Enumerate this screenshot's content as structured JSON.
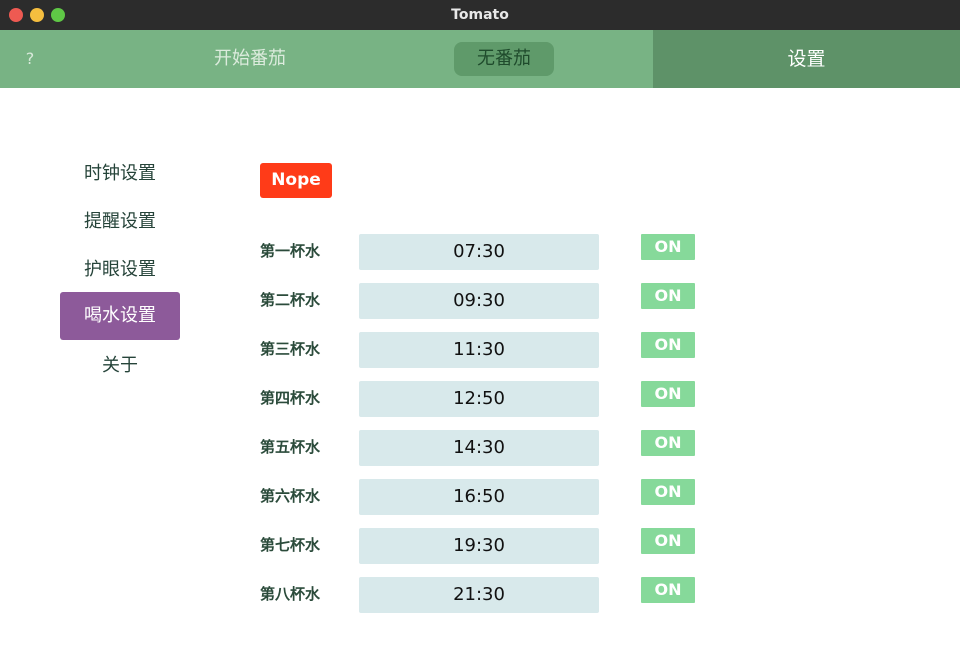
{
  "window": {
    "title": "Tomato"
  },
  "topnav": {
    "help": "?",
    "start": "开始番茄",
    "status": "无番茄",
    "settings": "设置"
  },
  "sidebar": {
    "items": [
      {
        "label": "时钟设置",
        "active": false
      },
      {
        "label": "提醒设置",
        "active": false
      },
      {
        "label": "护眼设置",
        "active": false
      },
      {
        "label": "喝水设置",
        "active": true
      },
      {
        "label": "关于",
        "active": false
      }
    ]
  },
  "main": {
    "nope_label": "Nope",
    "schedule": [
      {
        "label": "第一杯水",
        "time": "07:30",
        "toggle": "ON"
      },
      {
        "label": "第二杯水",
        "time": "09:30",
        "toggle": "ON"
      },
      {
        "label": "第三杯水",
        "time": "11:30",
        "toggle": "ON"
      },
      {
        "label": "第四杯水",
        "time": "12:50",
        "toggle": "ON"
      },
      {
        "label": "第五杯水",
        "time": "14:30",
        "toggle": "ON"
      },
      {
        "label": "第六杯水",
        "time": "16:50",
        "toggle": "ON"
      },
      {
        "label": "第七杯水",
        "time": "19:30",
        "toggle": "ON"
      },
      {
        "label": "第八杯水",
        "time": "21:30",
        "toggle": "ON"
      }
    ]
  },
  "colors": {
    "titlebar": "#2c2c2c",
    "topnav": "#78b384",
    "topnav_active": "#5e9268",
    "sidebar_active": "#8d5a9a",
    "nope": "#ff3b18",
    "time_input": "#d8e9eb",
    "toggle_on": "#86d99a"
  }
}
